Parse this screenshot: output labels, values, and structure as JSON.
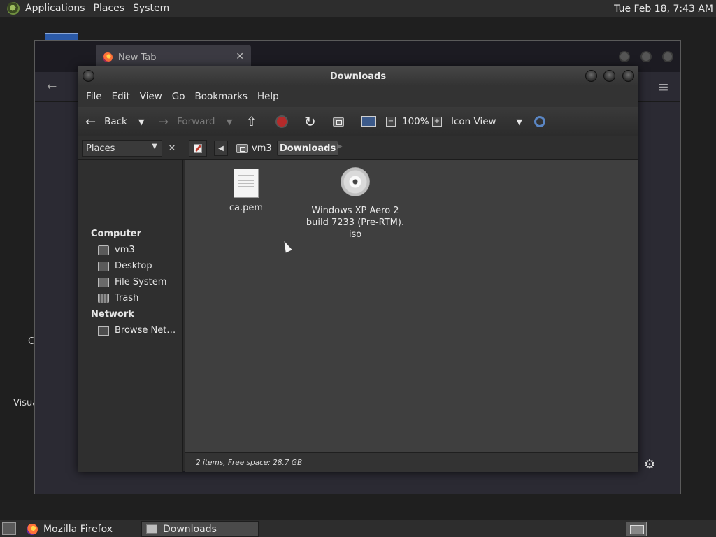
{
  "top_panel": {
    "menus": [
      "Applications",
      "Places",
      "System"
    ],
    "clock": "Tue Feb 18,  7:43 AM"
  },
  "desktop": {
    "partial_labels": [
      "C",
      "Visua"
    ]
  },
  "firefox": {
    "tab_title": "New Tab",
    "taskbar_label": "Mozilla Firefox"
  },
  "nautilus": {
    "title": "Downloads",
    "menubar": [
      "File",
      "Edit",
      "View",
      "Go",
      "Bookmarks",
      "Help"
    ],
    "toolbar": {
      "back": "Back",
      "forward": "Forward",
      "zoom": "100%",
      "view_mode": "Icon View"
    },
    "location": {
      "sidebar_combo": "Places",
      "crumbs": [
        "vm3",
        "Downloads"
      ]
    },
    "sidebar": {
      "computer_heading": "Computer",
      "computer_items": [
        "vm3",
        "Desktop",
        "File System",
        "Trash"
      ],
      "network_heading": "Network",
      "network_items": [
        "Browse Net…"
      ]
    },
    "files": [
      {
        "name": "ca.pem",
        "type": "document"
      },
      {
        "name": "Windows XP Aero 2 build 7233 (Pre-RTM). iso",
        "line1": "Windows XP Aero 2",
        "line2": "build 7233 (Pre-RTM).",
        "line3": "iso",
        "type": "disc-image"
      }
    ],
    "status": "2 items, Free space: 28.7 GB",
    "taskbar_label": "Downloads"
  }
}
